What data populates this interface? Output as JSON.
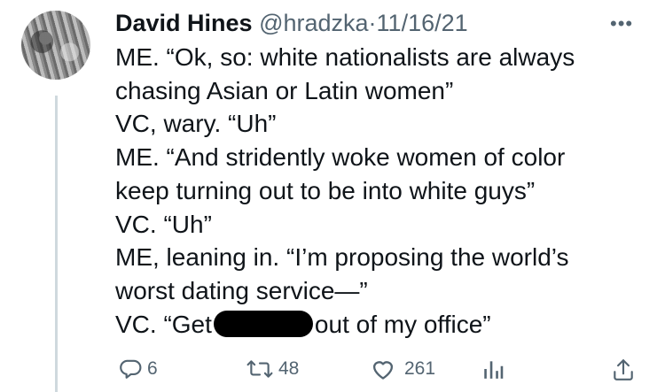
{
  "tweet": {
    "author_name": "David Hines",
    "handle": "@hradzka",
    "separator": "·",
    "date": "11/16/21",
    "more_label": "•••",
    "lines": [
      "ME. “Ok, so: white nationalists are always",
      "chasing Asian or Latin women”",
      "VC, wary. “Uh”",
      "ME. “And stridently woke women of color",
      "keep turning out to be into white guys”",
      "VC. “Uh”",
      "ME, leaning in. “I’m proposing the world’s",
      "worst dating service—”"
    ],
    "last_line_before": "VC. “Get",
    "last_line_after": "out of my office”"
  },
  "actions": {
    "replies": "6",
    "retweets": "48",
    "likes": "261"
  },
  "colors": {
    "text": "#0f1419",
    "secondary": "#536471",
    "thread_line": "#cfd9de"
  }
}
